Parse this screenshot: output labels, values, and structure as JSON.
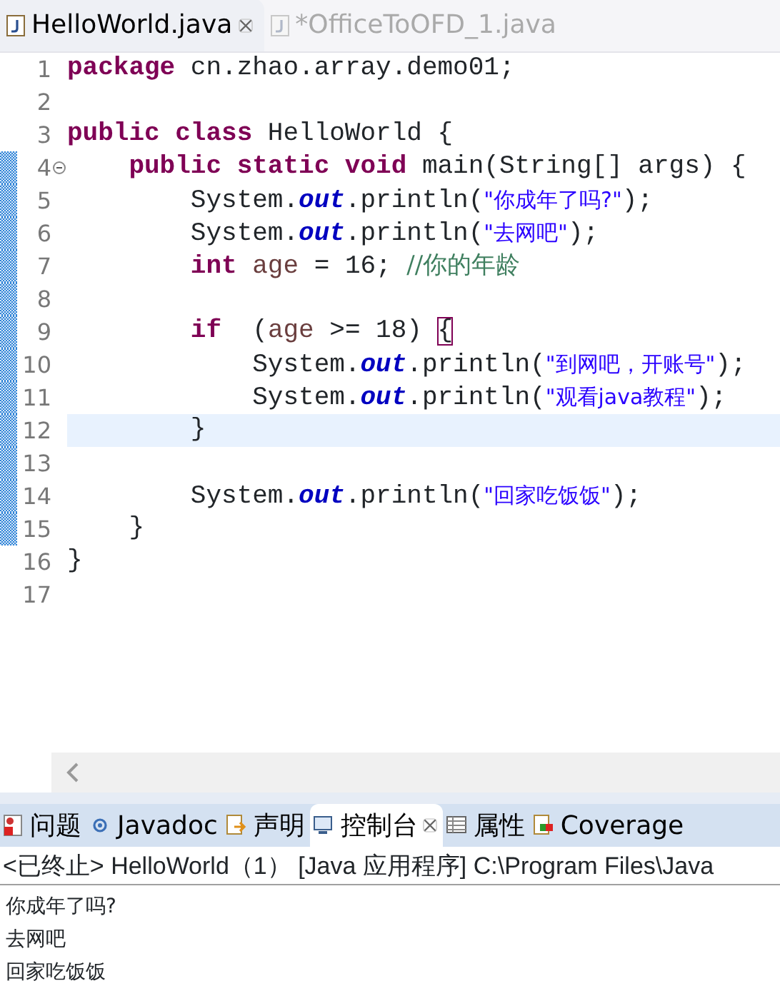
{
  "editor_tabs": [
    {
      "label": "HelloWorld.java",
      "selected": true
    },
    {
      "label": "*OfficeToOFD_1.java",
      "selected": false
    }
  ],
  "code_lines": [
    {
      "number": "1",
      "changed": false,
      "current": false,
      "fold": false,
      "tokens": [
        {
          "kind": "keyword",
          "text": "package"
        },
        {
          "kind": "plain",
          "text": " cn.zhao.array.demo01;"
        }
      ]
    },
    {
      "number": "2",
      "changed": false,
      "current": false,
      "fold": false
    },
    {
      "number": "3",
      "changed": false,
      "current": false,
      "fold": false,
      "tokens": [
        {
          "kind": "keyword",
          "text": "public class"
        },
        {
          "kind": "plain",
          "text": " HelloWorld {"
        }
      ]
    },
    {
      "number": "4",
      "changed": true,
      "current": false,
      "fold": true,
      "tokens": [
        {
          "kind": "keyword",
          "text": "    public static void"
        },
        {
          "kind": "plain",
          "text": " main(String[] args) {"
        }
      ]
    },
    {
      "number": "5",
      "changed": true,
      "current": false,
      "fold": false,
      "tokens": [
        {
          "kind": "plain",
          "text": "        System."
        },
        {
          "kind": "field",
          "text": "out"
        },
        {
          "kind": "plain",
          "text": ".println("
        },
        {
          "kind": "string",
          "text": "\"你成年了吗?\""
        },
        {
          "kind": "plain",
          "text": ");"
        }
      ]
    },
    {
      "number": "6",
      "changed": true,
      "current": false,
      "fold": false,
      "tokens": [
        {
          "kind": "plain",
          "text": "        System."
        },
        {
          "kind": "field",
          "text": "out"
        },
        {
          "kind": "plain",
          "text": ".println("
        },
        {
          "kind": "string",
          "text": "\"去网吧\""
        },
        {
          "kind": "plain",
          "text": ");"
        }
      ]
    },
    {
      "number": "7",
      "changed": true,
      "current": false,
      "fold": false,
      "tokens": [
        {
          "kind": "keyword",
          "text": "        int"
        },
        {
          "kind": "local",
          "text": " age"
        },
        {
          "kind": "plain",
          "text": " = 16; "
        },
        {
          "kind": "comment",
          "text": "//你的年龄"
        }
      ]
    },
    {
      "number": "8",
      "changed": true,
      "current": false,
      "fold": false
    },
    {
      "number": "9",
      "changed": true,
      "current": false,
      "fold": false,
      "tokens": [
        {
          "kind": "keyword",
          "text": "        if"
        },
        {
          "kind": "plain",
          "text": "  ("
        },
        {
          "kind": "local",
          "text": "age"
        },
        {
          "kind": "plain",
          "text": " >= 18) "
        },
        {
          "kind": "bracket",
          "text": "{"
        }
      ]
    },
    {
      "number": "10",
      "changed": true,
      "current": false,
      "fold": false,
      "tokens": [
        {
          "kind": "plain",
          "text": "            System."
        },
        {
          "kind": "field",
          "text": "out"
        },
        {
          "kind": "plain",
          "text": ".println("
        },
        {
          "kind": "string",
          "text": "\"到网吧，开账号\""
        },
        {
          "kind": "plain",
          "text": ");"
        }
      ]
    },
    {
      "number": "11",
      "changed": true,
      "current": false,
      "fold": false,
      "tokens": [
        {
          "kind": "plain",
          "text": "            System."
        },
        {
          "kind": "field",
          "text": "out"
        },
        {
          "kind": "plain",
          "text": ".println("
        },
        {
          "kind": "string",
          "text": "\"观看java教程\""
        },
        {
          "kind": "plain",
          "text": ");"
        }
      ]
    },
    {
      "number": "12",
      "changed": true,
      "current": true,
      "fold": false,
      "tokens": [
        {
          "kind": "plain",
          "text": "        }"
        }
      ]
    },
    {
      "number": "13",
      "changed": true,
      "current": false,
      "fold": false
    },
    {
      "number": "14",
      "changed": true,
      "current": false,
      "fold": false,
      "tokens": [
        {
          "kind": "plain",
          "text": "        System."
        },
        {
          "kind": "field",
          "text": "out"
        },
        {
          "kind": "plain",
          "text": ".println("
        },
        {
          "kind": "string",
          "text": "\"回家吃饭饭\""
        },
        {
          "kind": "plain",
          "text": ");"
        }
      ]
    },
    {
      "number": "15",
      "changed": true,
      "current": false,
      "fold": false,
      "tokens": [
        {
          "kind": "plain",
          "text": "    }"
        }
      ]
    },
    {
      "number": "16",
      "changed": false,
      "current": false,
      "fold": false,
      "tokens": [
        {
          "kind": "plain",
          "text": "}"
        }
      ]
    },
    {
      "number": "17",
      "changed": false,
      "current": false,
      "fold": false
    }
  ],
  "view_tabs": [
    {
      "kind": "problems",
      "label": "问题",
      "selected": false
    },
    {
      "kind": "javadoc",
      "label": "Javadoc",
      "selected": false
    },
    {
      "kind": "declaration",
      "label": "声明",
      "selected": false
    },
    {
      "kind": "console",
      "label": "控制台",
      "selected": true
    },
    {
      "kind": "properties",
      "label": "属性",
      "selected": false
    },
    {
      "kind": "coverage",
      "label": "Coverage",
      "selected": false
    }
  ],
  "console": {
    "header": "<已终止> HelloWorld（1）  [Java 应用程序] C:\\Program Files\\Java",
    "output": [
      "你成年了吗?",
      "去网吧",
      "回家吃饭饭"
    ]
  }
}
